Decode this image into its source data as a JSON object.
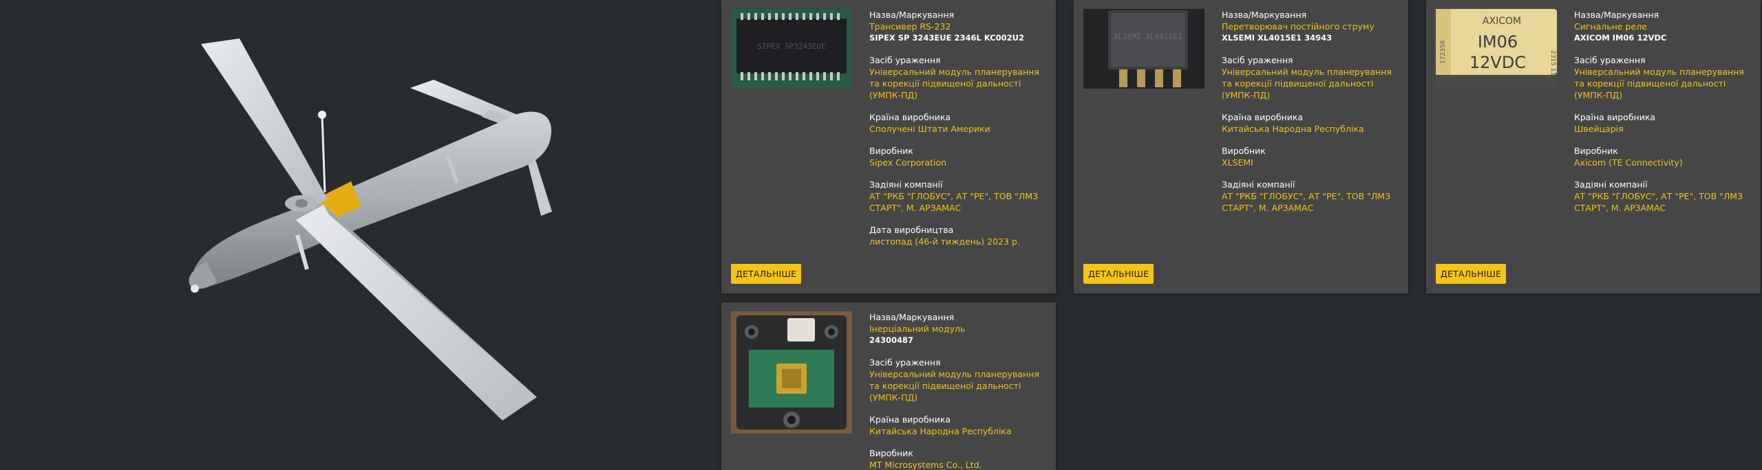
{
  "detail_button_label": "ДЕТАЛЬНІШЕ",
  "labels": {
    "name": "Назва/Маркування",
    "weapon": "Засіб ураження",
    "country": "Країна виробника",
    "manufacturer": "Виробник",
    "companies": "Задіяні компанії",
    "production_date": "Дата виробництва"
  },
  "cards": [
    {
      "name": "Трансивер RS-232",
      "marking": "SIPEX SP 3243EUE 2346L KC002U2",
      "weapon": "Універсальний модуль планерування та корекції підвищеної дальності (УМПК-ПД)",
      "country": "Сполучені Штати Америки",
      "manufacturer": "Sipex Corporation",
      "companies": "АТ \"РКБ \"ГЛОБУС\", АТ \"РЕ\", ТОВ \"ЛМЗ СТАРТ\", М. АРЗАМАС",
      "production_date": "листопад (46-й тиждень) 2023 р."
    },
    {
      "name": "Перетворювач постійного струму",
      "marking": "XLSEMI XL4015E1 34943",
      "weapon": "Універсальний модуль планерування та корекції підвищеної дальності (УМПК-ПД)",
      "country": "Китайська Народна Республіка",
      "manufacturer": "XLSEMI",
      "companies": "АТ \"РКБ \"ГЛОБУС\", АТ \"РЕ\", ТОВ \"ЛМЗ СТАРТ\", М. АРЗАМАС"
    },
    {
      "name": "Сигнальне реле",
      "marking": "AXICOM IM06 12VDC",
      "weapon": "Універсальний модуль планерування та корекції підвищеної дальності (УМПК-ПД)",
      "country": "Швейцарія",
      "manufacturer": "Axicom (TE Connectivity)",
      "companies": "АТ \"РКБ \"ГЛОБУС\", АТ \"РЕ\", ТОВ \"ЛМЗ СТАРТ\", М. АРЗАМАС"
    },
    {
      "name": "Інерціальний модуль",
      "marking": "24300487",
      "weapon": "Універсальний модуль планерування та корекції підвищеної дальності (УМПК-ПД)",
      "country": "Китайська Народна Республіка",
      "manufacturer": "MT Microsystems Co., Ltd."
    }
  ],
  "image_text": {
    "chip1": "SIPEX SP3243EUE",
    "chip2": "XLSEMI XL4015E1",
    "relay_brand": "AXICOM",
    "relay_model": "IM06",
    "relay_voltage": "12VDC",
    "relay_side": "172356",
    "relay_side2": "2315 11"
  },
  "colors": {
    "background": "#292c2f",
    "card": "#464646",
    "accent": "#f5c518",
    "value_text": "#f2c21b"
  }
}
